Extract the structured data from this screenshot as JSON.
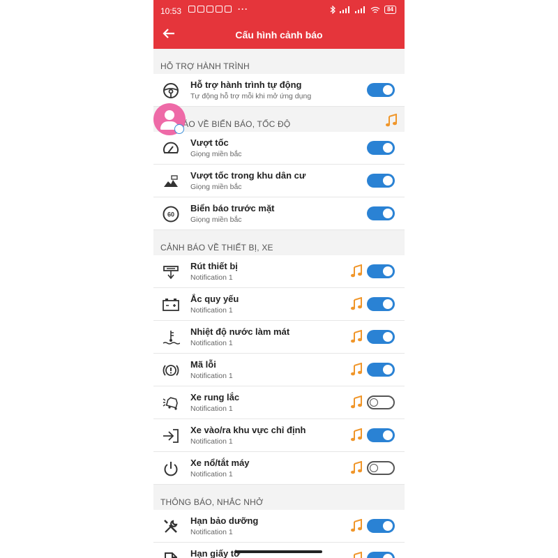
{
  "status_bar": {
    "time": "10:53",
    "battery": "84"
  },
  "app_bar": {
    "title": "Cấu hình cảnh báo"
  },
  "colors": {
    "brand": "#e5353b",
    "toggle_on": "#2a82d4",
    "sound_icon": "#f0962a"
  },
  "sections": [
    {
      "header": "HỖ TRỢ HÀNH TRÌNH",
      "items": [
        {
          "icon": "steering-wheel-icon",
          "label": "Hỗ trợ hành trình tự động",
          "sub": "Tự động hỗ trợ mỗi khi mở ứng dụng",
          "toggle": true
        }
      ]
    },
    {
      "header": "BÁO VỀ BIỂN BÁO, TỐC ĐỘ",
      "items": [
        {
          "icon": "speedometer-icon",
          "label": "Vượt tốc",
          "sub": "Giọng miền bắc",
          "toggle": true
        },
        {
          "icon": "residential-area-icon",
          "label": "Vượt tốc trong khu dân cư",
          "sub": "Giọng miền bắc",
          "toggle": true
        },
        {
          "icon": "speed-limit-60-icon",
          "icon_text": "60",
          "label": "Biển báo trước mặt",
          "sub": "Giọng miền bắc",
          "toggle": true
        }
      ]
    },
    {
      "header": "CẢNH BÁO VỀ THIẾT BỊ, XE",
      "items": [
        {
          "icon": "unplug-device-icon",
          "label": "Rút thiết bị",
          "sub": "Notification 1",
          "toggle": true
        },
        {
          "icon": "battery-icon",
          "label": "Ắc quy yếu",
          "sub": "Notification 1",
          "toggle": true
        },
        {
          "icon": "coolant-temperature-icon",
          "label": "Nhiệt độ nước làm mát",
          "sub": "Notification 1",
          "toggle": true
        },
        {
          "icon": "error-code-icon",
          "label": "Mã lỗi",
          "sub": "Notification 1",
          "toggle": true
        },
        {
          "icon": "car-shake-icon",
          "label": "Xe rung lắc",
          "sub": "Notification 1",
          "toggle": false
        },
        {
          "icon": "geofence-enter-icon",
          "label": "Xe vào/ra khu vực chỉ định",
          "sub": "Notification 1",
          "toggle": true
        },
        {
          "icon": "power-icon",
          "label": "Xe nổ/tắt máy",
          "sub": "Notification 1",
          "toggle": false
        }
      ]
    },
    {
      "header": "THÔNG BÁO, NHẮC NHỞ",
      "items": [
        {
          "icon": "maintenance-tools-icon",
          "label": "Hạn bảo dưỡng",
          "sub": "Notification 1",
          "toggle": true
        },
        {
          "icon": "documents-icon",
          "label": "Hạn giấy tờ",
          "sub": "",
          "toggle": true
        }
      ]
    }
  ]
}
